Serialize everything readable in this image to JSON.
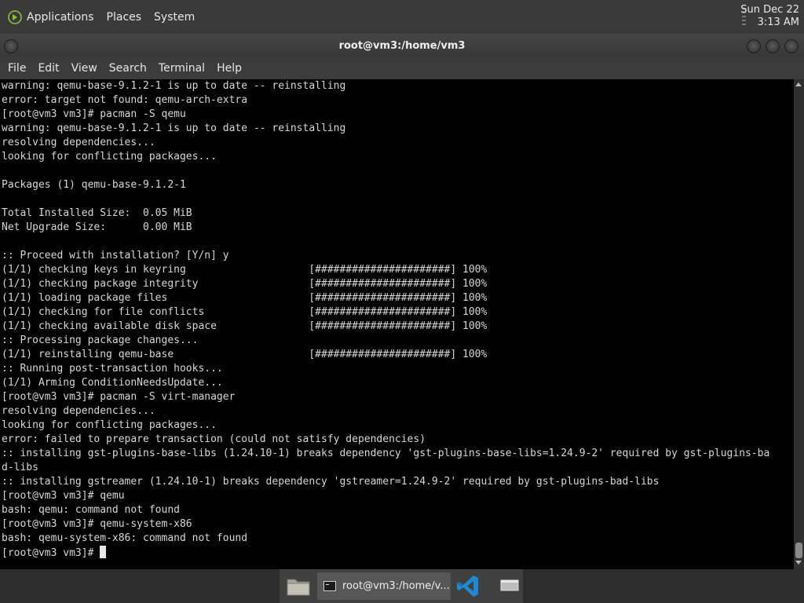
{
  "top_panel": {
    "menus": [
      "Applications",
      "Places",
      "System"
    ],
    "clock_date": "Sun Dec 22",
    "clock_time": "3:13 AM"
  },
  "window": {
    "title": "root@vm3:/home/vm3",
    "menus": [
      "File",
      "Edit",
      "View",
      "Search",
      "Terminal",
      "Help"
    ]
  },
  "terminal": {
    "lines": [
      "warning: qemu-base-9.1.2-1 is up to date -- reinstalling",
      "error: target not found: qemu-arch-extra",
      "[root@vm3 vm3]# pacman -S qemu",
      "warning: qemu-base-9.1.2-1 is up to date -- reinstalling",
      "resolving dependencies...",
      "looking for conflicting packages...",
      "",
      "Packages (1) qemu-base-9.1.2-1",
      "",
      "Total Installed Size:  0.05 MiB",
      "Net Upgrade Size:      0.00 MiB",
      "",
      ":: Proceed with installation? [Y/n] y",
      "(1/1) checking keys in keyring                    [######################] 100%",
      "(1/1) checking package integrity                  [######################] 100%",
      "(1/1) loading package files                       [######################] 100%",
      "(1/1) checking for file conflicts                 [######################] 100%",
      "(1/1) checking available disk space               [######################] 100%",
      ":: Processing package changes...",
      "(1/1) reinstalling qemu-base                      [######################] 100%",
      ":: Running post-transaction hooks...",
      "(1/1) Arming ConditionNeedsUpdate...",
      "[root@vm3 vm3]# pacman -S virt-manager",
      "resolving dependencies...",
      "looking for conflicting packages...",
      "error: failed to prepare transaction (could not satisfy dependencies)",
      ":: installing gst-plugins-base-libs (1.24.10-1) breaks dependency 'gst-plugins-base-libs=1.24.9-2' required by gst-plugins-ba",
      "d-libs",
      ":: installing gstreamer (1.24.10-1) breaks dependency 'gstreamer=1.24.9-2' required by gst-plugins-bad-libs",
      "[root@vm3 vm3]# qemu",
      "bash: qemu: command not found",
      "[root@vm3 vm3]# qemu-system-x86",
      "bash: qemu-system-x86: command not found"
    ],
    "prompt": "[root@vm3 vm3]# "
  },
  "taskbar": {
    "terminal_task_label": "root@vm3:/home/v...",
    "icons": [
      "file-manager-icon",
      "terminal-icon",
      "vscode-icon",
      "show-desktop-icon"
    ]
  },
  "colors": {
    "terminal_bg": "#000000",
    "terminal_fg": "#d6d6d6",
    "vscode_blue": "#1f8ad2"
  }
}
